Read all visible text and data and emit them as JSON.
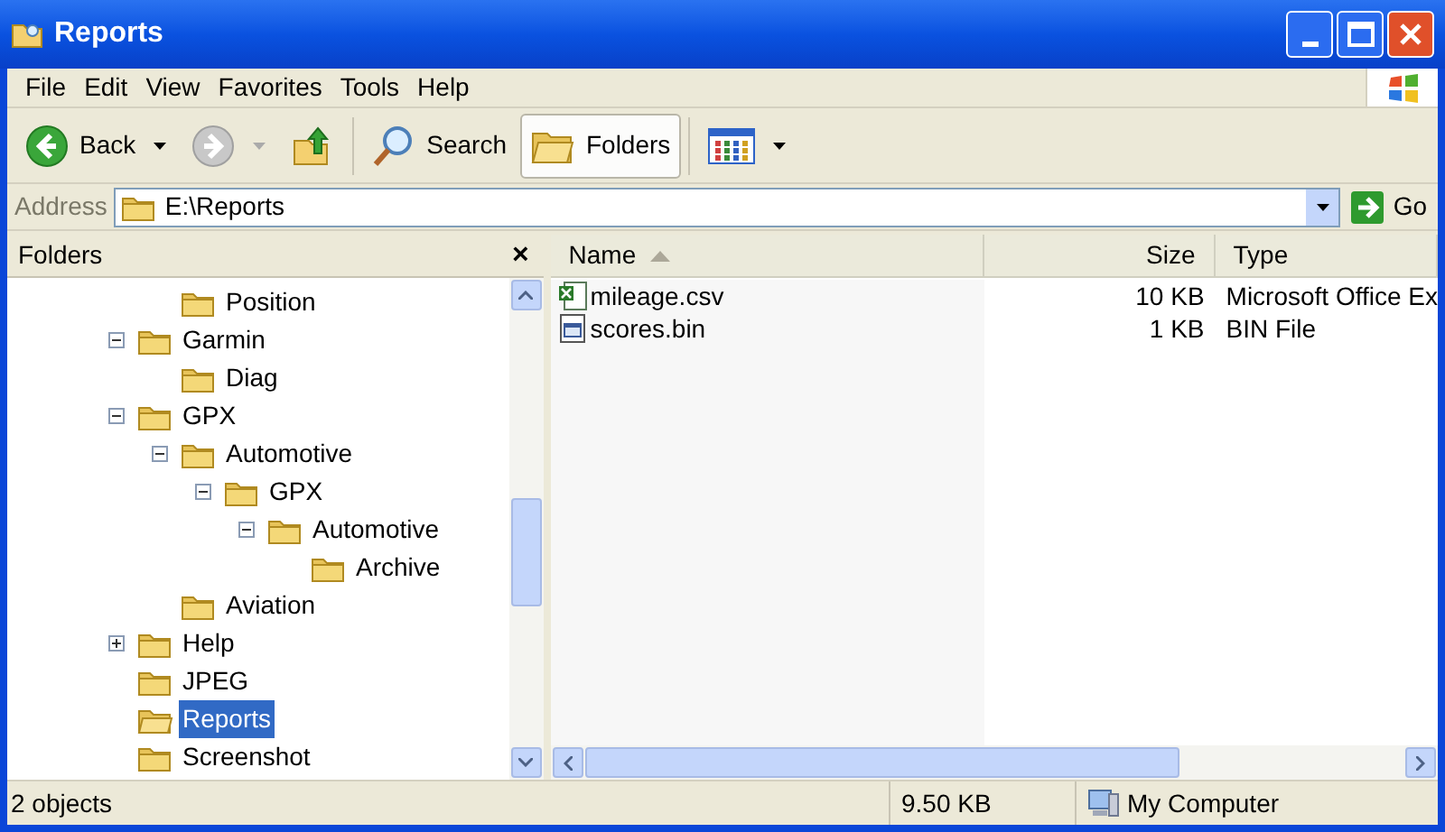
{
  "window": {
    "title": "Reports"
  },
  "menu": [
    "File",
    "Edit",
    "View",
    "Favorites",
    "Tools",
    "Help"
  ],
  "toolbar": [
    {
      "kind": "back",
      "label": "Back",
      "disabled": false
    },
    {
      "kind": "forward",
      "disabled": true
    },
    {
      "kind": "up"
    },
    {
      "kind": "search",
      "label": "Search",
      "on": false
    },
    {
      "kind": "folders",
      "label": "Folders",
      "on": true
    },
    {
      "kind": "views"
    }
  ],
  "address": {
    "label": "Address",
    "value": "E:\\Reports",
    "go": "Go"
  },
  "folders_pane": {
    "title": "Folders",
    "close": "×",
    "continued_children": [
      {
        "label": "Position",
        "selected": false
      }
    ],
    "items": [
      {
        "label": "Garmin",
        "selected": false,
        "expanded": true,
        "children": [
          {
            "label": "Diag",
            "selected": false
          }
        ]
      },
      {
        "label": "GPX",
        "selected": false,
        "expanded": true,
        "children": [
          {
            "label": "Automotive",
            "selected": false,
            "expanded": true,
            "children": [
              {
                "label": "GPX",
                "selected": false,
                "expanded": true,
                "children": [
                  {
                    "label": "Automotive",
                    "selected": false,
                    "expanded": true,
                    "children": [
                      {
                        "label": "Archive",
                        "selected": false
                      }
                    ]
                  }
                ]
              }
            ]
          },
          {
            "label": "Aviation",
            "selected": false
          }
        ]
      },
      {
        "label": "Help",
        "selected": false,
        "expanded": false
      },
      {
        "label": "JPEG",
        "selected": false
      },
      {
        "label": "Reports",
        "selected": true
      },
      {
        "label": "Screenshot",
        "selected": false
      }
    ]
  },
  "file_list": {
    "columns": [
      {
        "label": "Name",
        "sorted": true
      },
      {
        "label": "Size",
        "sorted": false
      },
      {
        "label": "Type",
        "sorted": false
      }
    ],
    "rows": [
      {
        "name": "mileage.csv",
        "size": "10 KB",
        "type": "Microsoft Office Ex",
        "kind": "spreadsheet"
      },
      {
        "name": "scores.bin",
        "size": "1 KB",
        "type": "BIN File",
        "kind": "binary"
      }
    ]
  },
  "status_bar": {
    "objects": "2 objects",
    "size": "9.50 KB",
    "location": "My Computer"
  }
}
